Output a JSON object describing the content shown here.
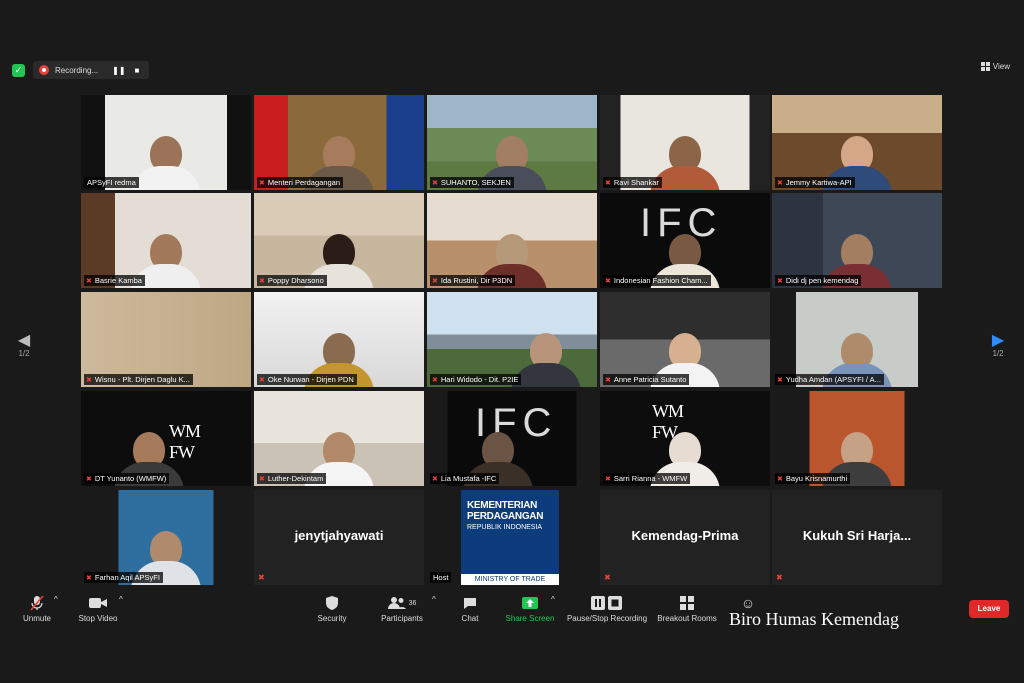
{
  "top": {
    "recording_label": "Recording...",
    "pause_glyph": "❚❚",
    "stop_glyph": "■",
    "view_label": "View"
  },
  "pager": {
    "left": "1/2",
    "right": "1/2"
  },
  "participants": [
    {
      "name": "APSyFI redma"
    },
    {
      "name": "Menteri Perdagangan"
    },
    {
      "name": "SUHANTO, SEKJEN"
    },
    {
      "name": "Ravi Shankar"
    },
    {
      "name": "Jemmy Kartiwa-API"
    },
    {
      "name": "Basrie Kamba"
    },
    {
      "name": "Poppy Dharsono"
    },
    {
      "name": "Ida Rustini, Dir P3DN"
    },
    {
      "name": "Indonesian Fashion Cham..."
    },
    {
      "name": "Didi dj pen kemendag"
    },
    {
      "name": "Wisnu - Plt. Dirjen Daglu K..."
    },
    {
      "name": "Oke Nurwan - Dirjen PDN"
    },
    {
      "name": "Hari Widodo - Dit. P2IE"
    },
    {
      "name": "Anne Patricia Sutanto"
    },
    {
      "name": "Yudha Amdan (APSYFI / A..."
    },
    {
      "name": "DT Yunanto (WMFW)"
    },
    {
      "name": "Luther-Dekintam"
    },
    {
      "name": "Lia Mustafa -IFC"
    },
    {
      "name": "Sarri Rianna - WMFW"
    },
    {
      "name": "Bayu Krisnamurthi"
    },
    {
      "name": "Farhan Aqil APSyFI"
    },
    {
      "name": "jenytjahyawati"
    },
    {
      "name": "Host"
    },
    {
      "name": "Kemendag-Prima"
    },
    {
      "name": "Kukuh Sri Harja..."
    }
  ],
  "kemendag_logo": {
    "line1": "KEMENTERIAN",
    "line2": "PERDAGANGAN",
    "line3": "REPUBLIK INDONESIA",
    "line4": "MINISTRY OF TRADE"
  },
  "toolbar": {
    "unmute": "Unmute",
    "stop_video": "Stop Video",
    "security": "Security",
    "participants": "Participants",
    "participants_count": "36",
    "chat": "Chat",
    "share_screen": "Share Screen",
    "pause_stop_recording": "Pause/Stop Recording",
    "breakout_rooms": "Breakout Rooms",
    "reactions_glyph": "☺",
    "leave": "Leave"
  },
  "watermark": "Biro Humas Kemendag",
  "colors": {
    "active_speaker": "#e6e86c",
    "leave": "#e02828",
    "share_green": "#23c552",
    "muted_red": "#e8413a",
    "pager_blue": "#2d8cff"
  }
}
